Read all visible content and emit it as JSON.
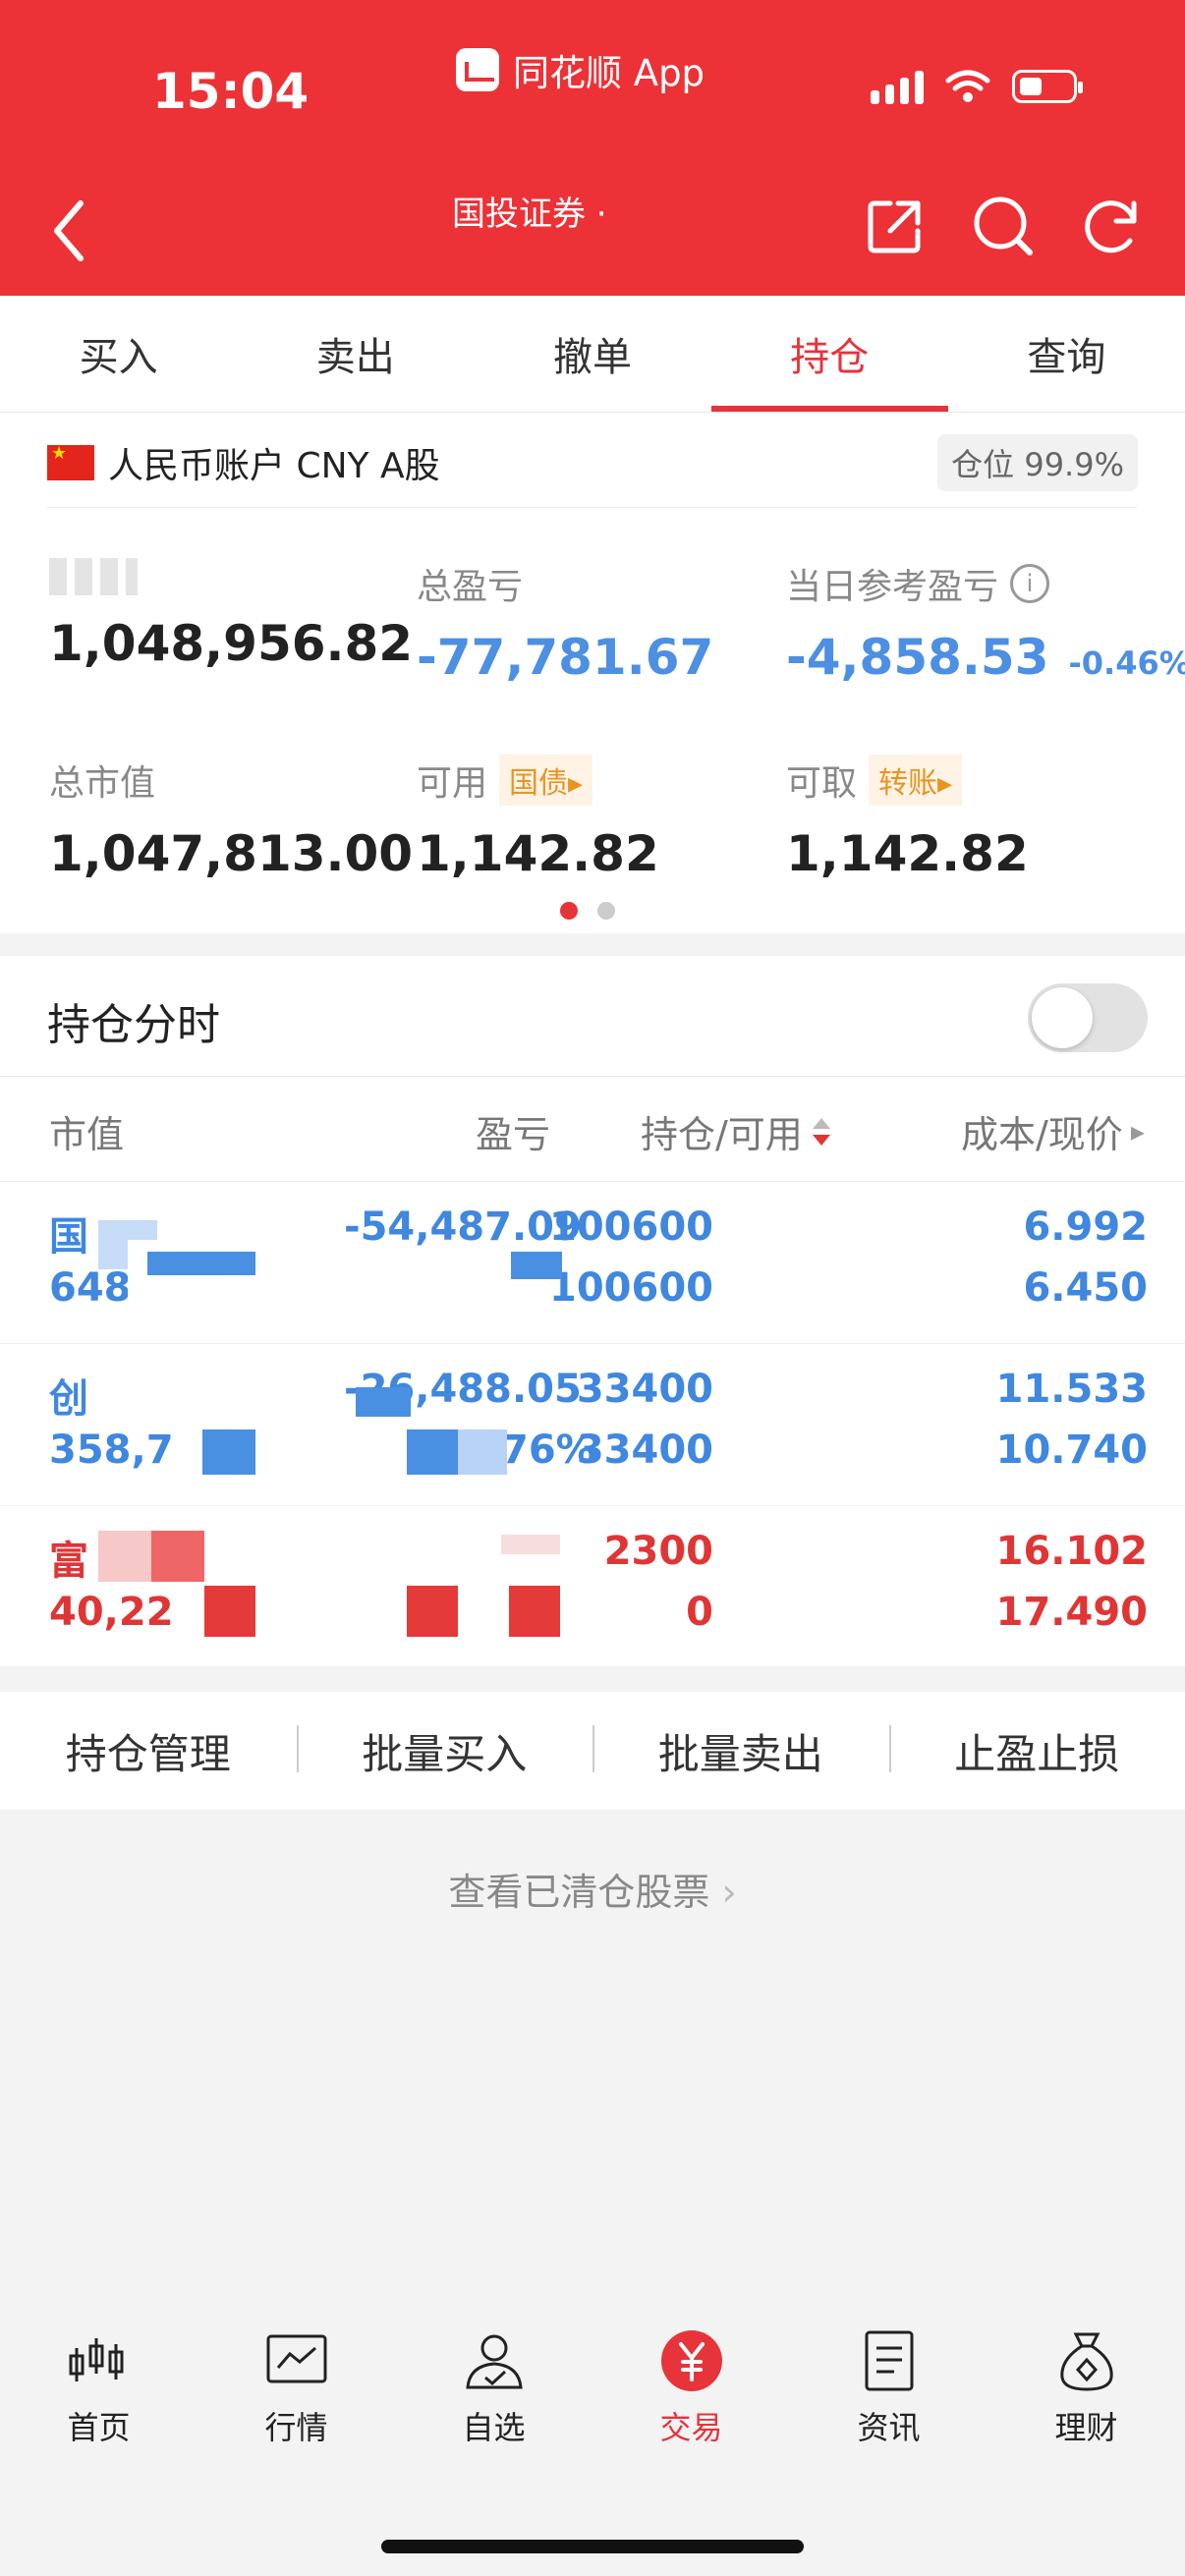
{
  "status_bar": {
    "time": "15:04",
    "app_label": "同花顺 App"
  },
  "nav": {
    "title": "国投证券 ·"
  },
  "tabs": [
    {
      "label": "买入"
    },
    {
      "label": "卖出"
    },
    {
      "label": "撤单"
    },
    {
      "label": "持仓",
      "active": true
    },
    {
      "label": "查询"
    }
  ],
  "account": {
    "name": "人民币账户 CNY A股",
    "position_label": "仓位 99.9%",
    "metrics": {
      "total_assets_value": "1,048,956.82",
      "total_pnl_label": "总盈亏",
      "total_pnl_value": "-77,781.67",
      "daily_pnl_label": "当日参考盈亏",
      "daily_pnl_value": "-4,858.53",
      "daily_pnl_pct": "-0.46%",
      "market_value_label": "总市值",
      "market_value": "1,047,813.00",
      "available_label": "可用",
      "available_tag": "国债",
      "available_value": "1,142.82",
      "withdrawable_label": "可取",
      "withdrawable_tag": "转账",
      "withdrawable_value": "1,142.82"
    }
  },
  "holdings_section": {
    "title": "持仓分时",
    "toggle_on": false
  },
  "table": {
    "headers": [
      "市值",
      "盈亏",
      "持仓/可用",
      "成本/现价"
    ],
    "rows": [
      {
        "name": "国",
        "market_value": "648,8",
        "pnl": "-54,487.09",
        "pnl_pct": "",
        "position": "100600",
        "available": "100600",
        "cost": "6.992",
        "price": "6.450",
        "color": "blue"
      },
      {
        "name": "创",
        "market_value": "358,7",
        "pnl": "-26,488.05",
        "pnl_pct": "76%",
        "position": "33400",
        "available": "33400",
        "cost": "11.533",
        "price": "10.740",
        "color": "blue"
      },
      {
        "name": "富",
        "market_value": "40,22",
        "pnl": "",
        "pnl_pct": "",
        "position": "2300",
        "available": "0",
        "cost": "16.102",
        "price": "17.490",
        "color": "red"
      }
    ]
  },
  "actions": [
    "持仓管理",
    "批量买入",
    "批量卖出",
    "止盈止损"
  ],
  "cleared_link": "查看已清仓股票",
  "bottom_nav": [
    {
      "label": "首页",
      "icon": "candlestick-icon"
    },
    {
      "label": "行情",
      "icon": "chart-icon"
    },
    {
      "label": "自选",
      "icon": "user-check-icon"
    },
    {
      "label": "交易",
      "icon": "yuan-icon",
      "active": true
    },
    {
      "label": "资讯",
      "icon": "document-icon"
    },
    {
      "label": "理财",
      "icon": "moneybag-icon"
    }
  ],
  "colors": {
    "brand_red": "#ec3237",
    "gain_red": "#e03535",
    "loss_blue": "#3f87df",
    "tag_orange": "#e99421"
  }
}
